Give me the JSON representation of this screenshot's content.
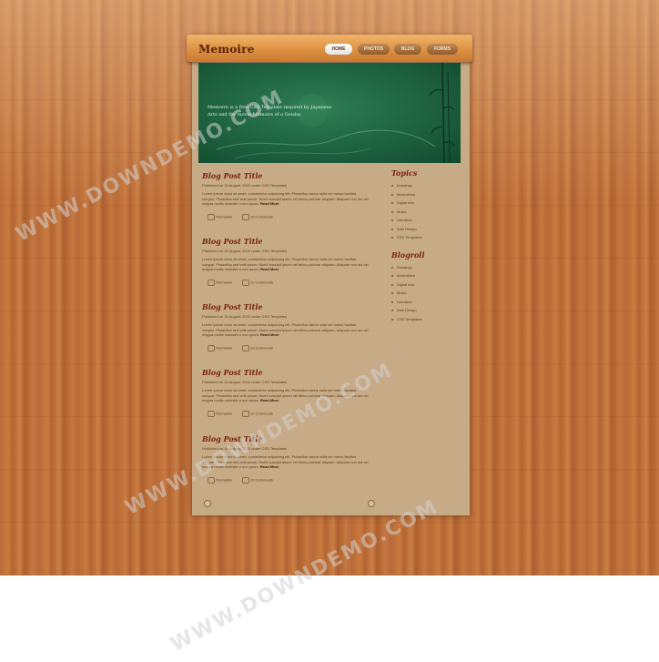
{
  "site": {
    "logo": "Memoire"
  },
  "nav": {
    "items": [
      "HOME",
      "PHOTOS",
      "BLOG",
      "FORMS"
    ],
    "active": "HOME"
  },
  "hero": {
    "text": "Memoire is a free CSS Template inspired by Japanese Arts and the movie Memoirs of a Geisha."
  },
  "posts": [
    {
      "title": "Blog Post Title",
      "meta": "Published on 16 August, 2010 under CSS Templates",
      "body": "Lorem ipsum dolor sit amet, consectetur adipiscing elit. Phasellus varius nulla vel metus facilisis congue. Phasellus sed velit ipsum. Morbi suscipit ipsum vel tellus pulvinar aliquam. Aliquam non dui vel magna mollis molestie a non quam.",
      "read_more": "Read More",
      "permalink": "Permalink",
      "comments": "10 Comments"
    },
    {
      "title": "Blog Post Title",
      "meta": "Published on 16 August, 2010 under CSS Templates",
      "body": "Lorem ipsum dolor sit amet, consectetur adipiscing elit. Phasellus varius nulla vel metus facilisis congue. Phasellus sed velit ipsum. Morbi suscipit ipsum vel tellus pulvinar aliquam. Aliquam non dui vel magna mollis molestie a non quam.",
      "read_more": "Read More",
      "permalink": "Permalink",
      "comments": "10 Comments"
    },
    {
      "title": "Blog Post Title",
      "meta": "Published on 16 August, 2010 under CSS Templates",
      "body": "Lorem ipsum dolor sit amet, consectetur adipiscing elit. Phasellus varius nulla vel metus facilisis congue. Phasellus sed velit ipsum. Morbi suscipit ipsum vel tellus pulvinar aliquam. Aliquam non dui vel magna mollis molestie a non quam.",
      "read_more": "Read More",
      "permalink": "Permalink",
      "comments": "10 Comments"
    },
    {
      "title": "Blog Post Title",
      "meta": "Published on 16 August, 2010 under CSS Templates",
      "body": "Lorem ipsum dolor sit amet, consectetur adipiscing elit. Phasellus varius nulla vel metus facilisis congue. Phasellus sed velit ipsum. Morbi suscipit ipsum vel tellus pulvinar aliquam. Aliquam non dui vel magna mollis molestie a non quam.",
      "read_more": "Read More",
      "permalink": "Permalink",
      "comments": "10 Comments"
    },
    {
      "title": "Blog Post Title",
      "meta": "Published on 16 August, 2010 under CSS Templates",
      "body": "Lorem ipsum dolor sit amet, consectetur adipiscing elit. Phasellus varius nulla vel metus facilisis congue. Phasellus sed velit ipsum. Morbi suscipit ipsum vel tellus pulvinar aliquam. Aliquam non dui vel magna mollis molestie a non quam.",
      "read_more": "Read More",
      "permalink": "Permalink",
      "comments": "10 Comments"
    }
  ],
  "sidebar": {
    "topics": {
      "heading": "Topics",
      "items": [
        "Drawings",
        "Illustrations",
        "Digital Arts",
        "Music",
        "Literature",
        "Web Design",
        "CSS Templates"
      ]
    },
    "blogroll": {
      "heading": "Blogroll",
      "items": [
        "Drawings",
        "Illustrations",
        "Digital Arts",
        "Music",
        "Literature",
        "Web Design",
        "CSS Templates"
      ]
    }
  },
  "watermark": "WWW.DOWNDEMO.COM",
  "colors": {
    "wood": "#c07540",
    "panel": "#c7ab86",
    "accent": "#7a2410",
    "hero": "#1e6240"
  }
}
